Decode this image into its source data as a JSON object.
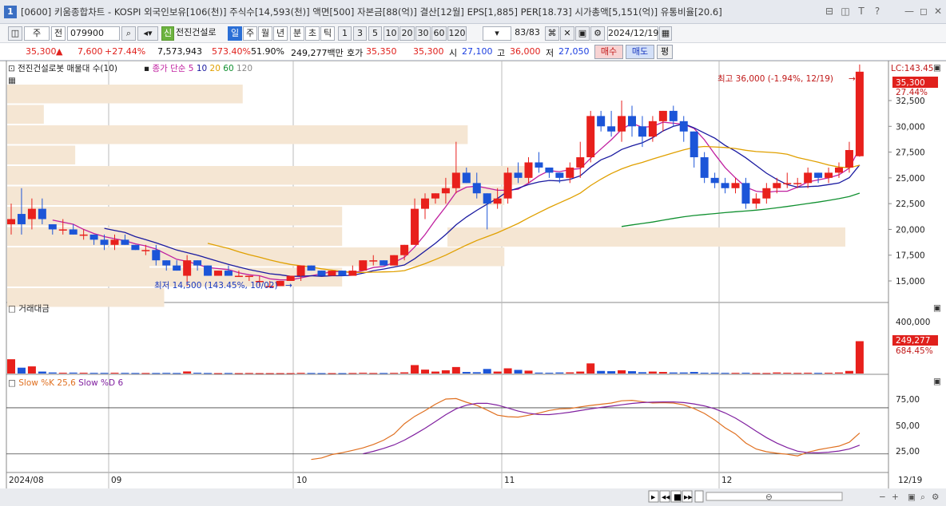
{
  "window": {
    "number": "1",
    "title": "[0600] 키움종합차트 - KOSPI 외국인보유[106(천)] 주식수[14,593(천)] 액면[500] 자본금[88(억)] 결산[12월] EPS[1,885] PER[18.73] 시가총액[5,151(억)] 유통비율[20.6]",
    "buttons": [
      "⊟",
      "◫",
      "T",
      "?",
      "—",
      "◻",
      "✕"
    ]
  },
  "toolbar": {
    "market": "주",
    "scope": "전",
    "code": "079900",
    "stock_name": "전진건설로",
    "periods": [
      "일",
      "주",
      "월",
      "년",
      "분",
      "초",
      "틱"
    ],
    "selected_period": "일",
    "intervals": [
      "1",
      "3",
      "5",
      "10",
      "20",
      "30",
      "60",
      "120"
    ],
    "count": "83/83",
    "date": "2024/12/19",
    "prefix_badge": "신"
  },
  "pricebar": {
    "price": "35,300",
    "change_sign": "▲",
    "change": "7,600",
    "change_pct": "+27.44%",
    "volume": "7,573,943",
    "volume_pct": "573.40%",
    "ratio": "51.90%",
    "amount": "249,277백만",
    "quote_label": "호가",
    "ask": "35,350",
    "bid": "35,300",
    "open_label": "시",
    "open": "27,100",
    "high_label": "고",
    "high": "36,000",
    "low_label": "저",
    "low": "27,050",
    "buy_label": "매수",
    "sell_label": "매도",
    "eval_label": "평"
  },
  "price_panel": {
    "legend_name": "전진건설로봇 매물대 수(10)",
    "ma_label": "종가 단순",
    "ma_periods": [
      "5",
      "10",
      "20",
      "60",
      "120"
    ],
    "ma_colors": [
      "#c020a0",
      "#1a1aa0",
      "#e0a000",
      "#109030",
      "#888888"
    ],
    "high_annotation": "최고 36,000 (-1.94%, 12/19)",
    "low_annotation": "최저 14,500 (143.45%, 10/02)",
    "lc_label": "LC:143.45",
    "price_tag": "35,300",
    "pct_tag": "27.44%",
    "y_ticks": [
      "32,500",
      "30,000",
      "27,500",
      "25,000",
      "22,500",
      "20,000",
      "17,500",
      "15,000"
    ]
  },
  "volume_panel": {
    "title": "거래대금",
    "y_ticks": [
      "400,000"
    ],
    "value_tag": "249,277",
    "pct_tag": "684.45%"
  },
  "stoch_panel": {
    "title_k": "Slow %K 25,6",
    "title_d": "Slow %D 6",
    "y_ticks": [
      "75,00",
      "50,00",
      "25,00"
    ]
  },
  "x_axis": {
    "labels": [
      "2024/08",
      "09",
      "10",
      "11",
      "12"
    ],
    "last_date": "12/19"
  },
  "colors": {
    "up": "#e8201c",
    "down": "#1c55d8",
    "volume_box": "#f5e6d3"
  },
  "chart_data": {
    "type": "candlestick",
    "candles": [
      [
        20500,
        22500,
        19500,
        21000
      ],
      [
        21500,
        24000,
        19500,
        20500
      ],
      [
        21000,
        23000,
        20000,
        22000
      ],
      [
        22000,
        23000,
        20500,
        21000
      ],
      [
        20500,
        20500,
        19500,
        20000
      ],
      [
        20000,
        21000,
        19500,
        20000
      ],
      [
        20000,
        20500,
        19500,
        19500
      ],
      [
        19500,
        20000,
        19000,
        19500
      ],
      [
        19500,
        19500,
        18500,
        19000
      ],
      [
        19000,
        19500,
        18000,
        18500
      ],
      [
        18500,
        19500,
        18000,
        19000
      ],
      [
        19000,
        19500,
        18500,
        18500
      ],
      [
        18500,
        18500,
        18000,
        18000
      ],
      [
        18000,
        18500,
        17500,
        18000
      ],
      [
        18000,
        18500,
        16500,
        17000
      ],
      [
        17000,
        17000,
        16000,
        16500
      ],
      [
        16500,
        17000,
        16000,
        16000
      ],
      [
        15500,
        17500,
        14500,
        17000
      ],
      [
        17000,
        17000,
        16000,
        16500
      ],
      [
        16500,
        16500,
        15500,
        15500
      ],
      [
        15500,
        16000,
        15500,
        16000
      ],
      [
        16000,
        16500,
        15500,
        15500
      ],
      [
        15500,
        16000,
        15500,
        15500
      ],
      [
        15500,
        15500,
        15000,
        15500
      ],
      [
        15000,
        15500,
        14500,
        15000
      ],
      [
        14500,
        15000,
        14500,
        14500
      ],
      [
        14500,
        15000,
        14500,
        15000
      ],
      [
        15000,
        15500,
        15000,
        15500
      ],
      [
        15500,
        16500,
        15000,
        16500
      ],
      [
        16500,
        16500,
        16000,
        16000
      ],
      [
        16000,
        16000,
        15500,
        15500
      ],
      [
        15500,
        16000,
        15500,
        16000
      ],
      [
        16000,
        16000,
        15500,
        15500
      ],
      [
        15500,
        16500,
        15500,
        16000
      ],
      [
        16000,
        17000,
        16000,
        17000
      ],
      [
        17000,
        17500,
        16500,
        17000
      ],
      [
        17000,
        17000,
        16500,
        16500
      ],
      [
        16500,
        17500,
        16500,
        17500
      ],
      [
        17500,
        18500,
        17000,
        18500
      ],
      [
        18500,
        23000,
        18500,
        22000
      ],
      [
        22000,
        23500,
        21000,
        23000
      ],
      [
        23000,
        23500,
        22500,
        23500
      ],
      [
        23500,
        25000,
        22500,
        24000
      ],
      [
        24000,
        28500,
        23500,
        25500
      ],
      [
        25500,
        26000,
        24500,
        24500
      ],
      [
        24500,
        25500,
        23000,
        23500
      ],
      [
        23500,
        23500,
        20000,
        22500
      ],
      [
        22500,
        24000,
        22000,
        23000
      ],
      [
        23000,
        26000,
        22500,
        25500
      ],
      [
        25500,
        26500,
        24500,
        25000
      ],
      [
        25000,
        27000,
        24500,
        26500
      ],
      [
        26500,
        27500,
        25500,
        26000
      ],
      [
        26000,
        26000,
        25000,
        25500
      ],
      [
        25500,
        25500,
        24500,
        25000
      ],
      [
        25000,
        26500,
        24500,
        26000
      ],
      [
        26000,
        28500,
        25000,
        27000
      ],
      [
        27000,
        31500,
        26500,
        31000
      ],
      [
        31000,
        31500,
        29500,
        30000
      ],
      [
        30000,
        31500,
        29000,
        29500
      ],
      [
        29500,
        32500,
        28500,
        31000
      ],
      [
        31000,
        32000,
        29000,
        30000
      ],
      [
        30000,
        31000,
        28000,
        29000
      ],
      [
        29000,
        31000,
        28500,
        30500
      ],
      [
        30500,
        31500,
        29500,
        31500
      ],
      [
        31500,
        32000,
        30000,
        30500
      ],
      [
        30500,
        31000,
        28500,
        29500
      ],
      [
        29500,
        29500,
        26000,
        27000
      ],
      [
        27000,
        27500,
        24500,
        25000
      ],
      [
        25000,
        25500,
        24000,
        24500
      ],
      [
        24500,
        25000,
        23500,
        24000
      ],
      [
        24000,
        25000,
        23500,
        24500
      ],
      [
        24500,
        25000,
        22000,
        22500
      ],
      [
        22500,
        23500,
        22000,
        23000
      ],
      [
        23000,
        24500,
        22500,
        24000
      ],
      [
        24000,
        25000,
        23500,
        24500
      ],
      [
        24500,
        25500,
        24000,
        24500
      ],
      [
        24500,
        25000,
        24000,
        24500
      ],
      [
        24500,
        26000,
        24000,
        25500
      ],
      [
        25500,
        25500,
        24500,
        25000
      ],
      [
        25000,
        26000,
        24500,
        25500
      ],
      [
        25500,
        26500,
        25000,
        26000
      ],
      [
        26000,
        28500,
        25500,
        27700
      ],
      [
        27100,
        36000,
        27050,
        35300
      ]
    ],
    "volume_amount": [
      110000,
      45000,
      55000,
      15000,
      8000,
      6000,
      7000,
      6000,
      5000,
      5000,
      6000,
      5000,
      4000,
      4000,
      4000,
      5000,
      4000,
      16000,
      6000,
      4000,
      3000,
      4000,
      3000,
      4000,
      3000,
      3000,
      3000,
      3000,
      5000,
      4000,
      3000,
      3000,
      3000,
      4000,
      6000,
      4000,
      4000,
      5000,
      9000,
      65000,
      30000,
      15000,
      25000,
      50000,
      12000,
      10000,
      35000,
      15000,
      40000,
      28000,
      22000,
      7000,
      6000,
      8000,
      9000,
      15000,
      78000,
      20000,
      18000,
      25000,
      18000,
      10000,
      15000,
      12000,
      8000,
      8000,
      12000,
      6000,
      6000,
      5000,
      5000,
      6000,
      4000,
      4000,
      8000,
      6000,
      5000,
      6000,
      5000,
      6000,
      8000,
      20000,
      249277
    ],
    "slow_k": [
      null,
      null,
      null,
      null,
      null,
      null,
      null,
      null,
      null,
      null,
      null,
      null,
      null,
      null,
      null,
      null,
      null,
      null,
      null,
      null,
      null,
      null,
      null,
      null,
      null,
      null,
      null,
      null,
      null,
      null,
      null,
      null,
      null,
      null,
      null,
      null,
      null,
      null,
      null,
      null,
      null,
      null,
      null,
      null,
      null,
      null,
      null,
      null,
      null,
      null,
      null,
      null,
      null,
      null,
      null,
      null,
      null,
      null,
      null,
      null,
      null,
      null,
      null,
      null,
      null,
      null,
      null,
      null,
      null,
      null,
      null,
      null,
      null,
      null,
      null,
      null,
      null,
      null,
      null,
      null,
      null,
      null,
      null
    ],
    "volume_profile_rel": [
      0.45,
      0.07,
      0.88,
      0.13,
      1.0,
      0.95,
      0.64,
      0.64,
      0.95,
      0.64,
      0.3
    ]
  }
}
